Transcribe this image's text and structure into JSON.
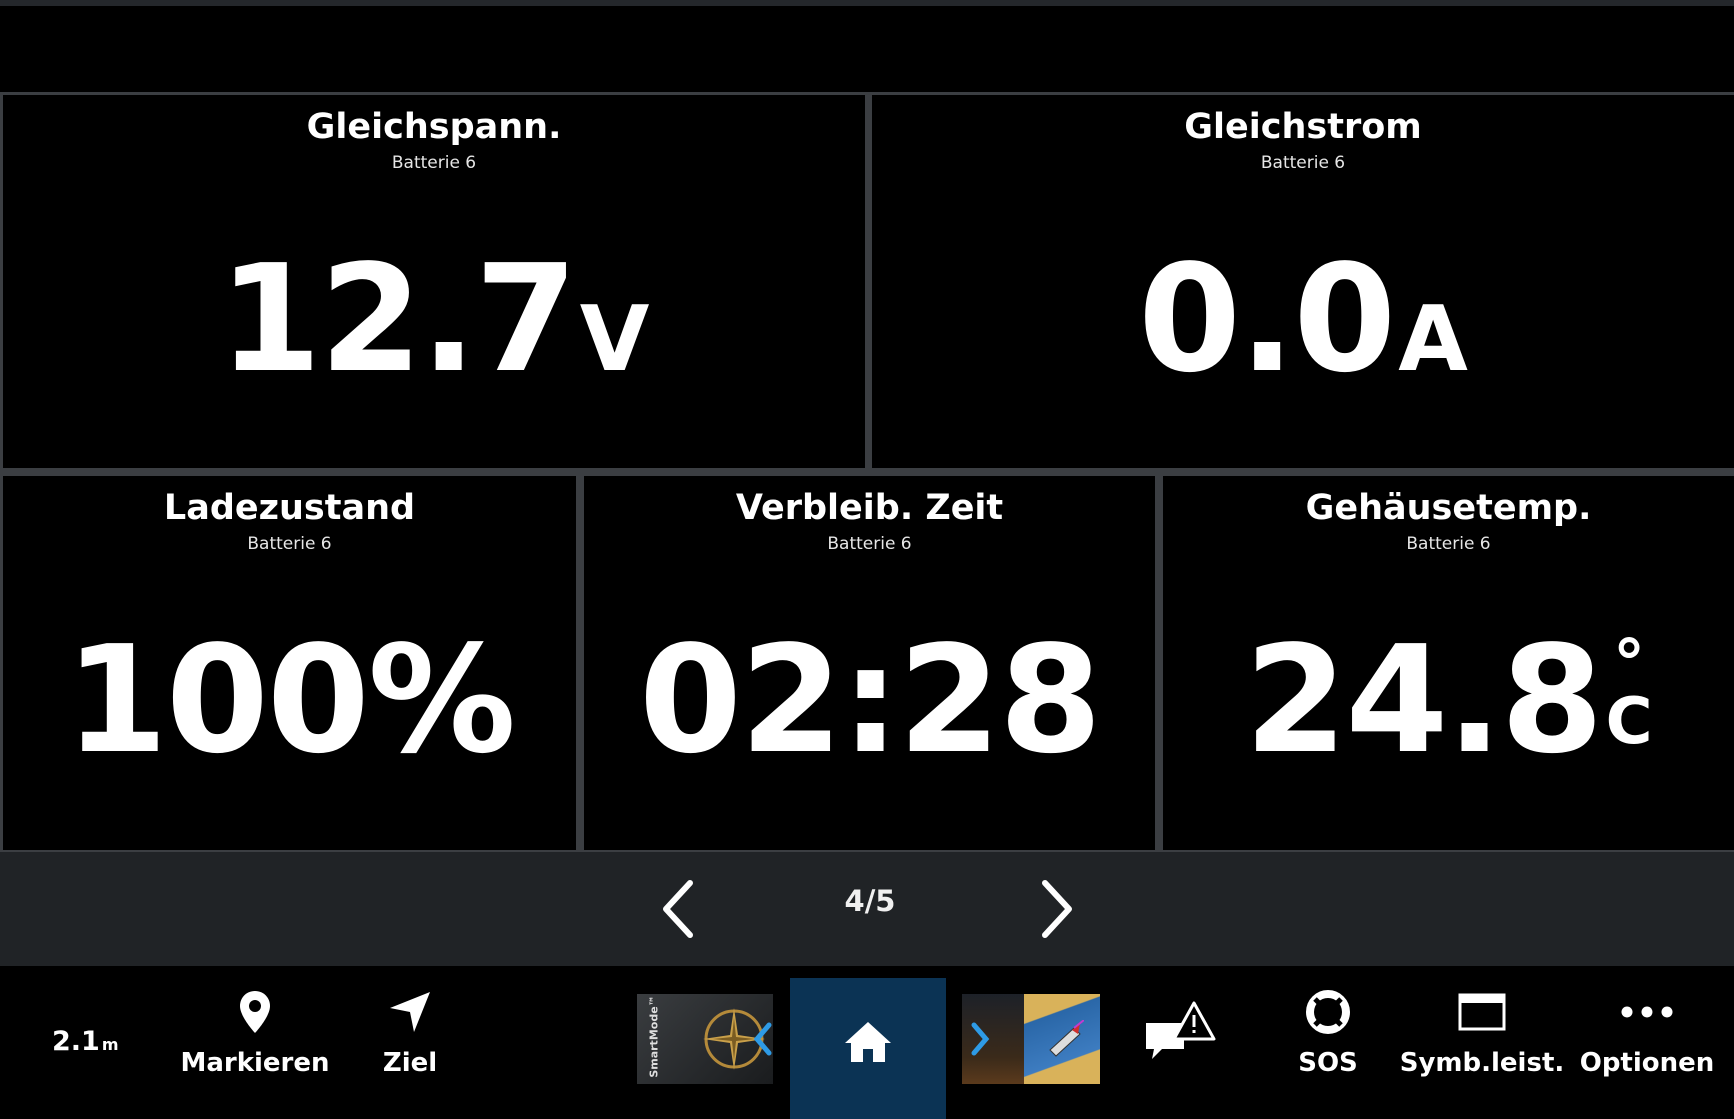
{
  "tiles": [
    {
      "title": "Gleichspann.",
      "subtitle": "Batterie 6",
      "value": "12.7",
      "unit": "V"
    },
    {
      "title": "Gleichstrom",
      "subtitle": "Batterie 6",
      "value": "0.0",
      "unit": "A"
    },
    {
      "title": "Ladezustand",
      "subtitle": "Batterie 6",
      "value": "100%",
      "unit": ""
    },
    {
      "title": "Verbleib. Zeit",
      "subtitle": "Batterie 6",
      "value": "02:28",
      "unit": ""
    },
    {
      "title": "Gehäusetemp.",
      "subtitle": "Batterie 6",
      "value": "24.8",
      "unit_top": "°",
      "unit_bottom": "C"
    }
  ],
  "pager": {
    "indicator": "4/5",
    "prev_icon": "chevron-left-icon",
    "next_icon": "chevron-right-icon"
  },
  "bottombar": {
    "depth_value": "2.1",
    "depth_unit": "m",
    "markieren_label": "Markieren",
    "ziel_label": "Ziel",
    "smartmode_text": "SmartMode™",
    "sos_label": "SOS",
    "symbol_label": "Symb.leist.",
    "options_label": "Optionen",
    "home_icon": "home-icon",
    "alarm_icon": "alarm-messages-icon"
  },
  "colors": {
    "background": "#000000",
    "tile_border": "#3b3e42",
    "pager_bg": "#202326",
    "home_highlight": "#0b3354",
    "accent_blue": "#2e9be6"
  }
}
